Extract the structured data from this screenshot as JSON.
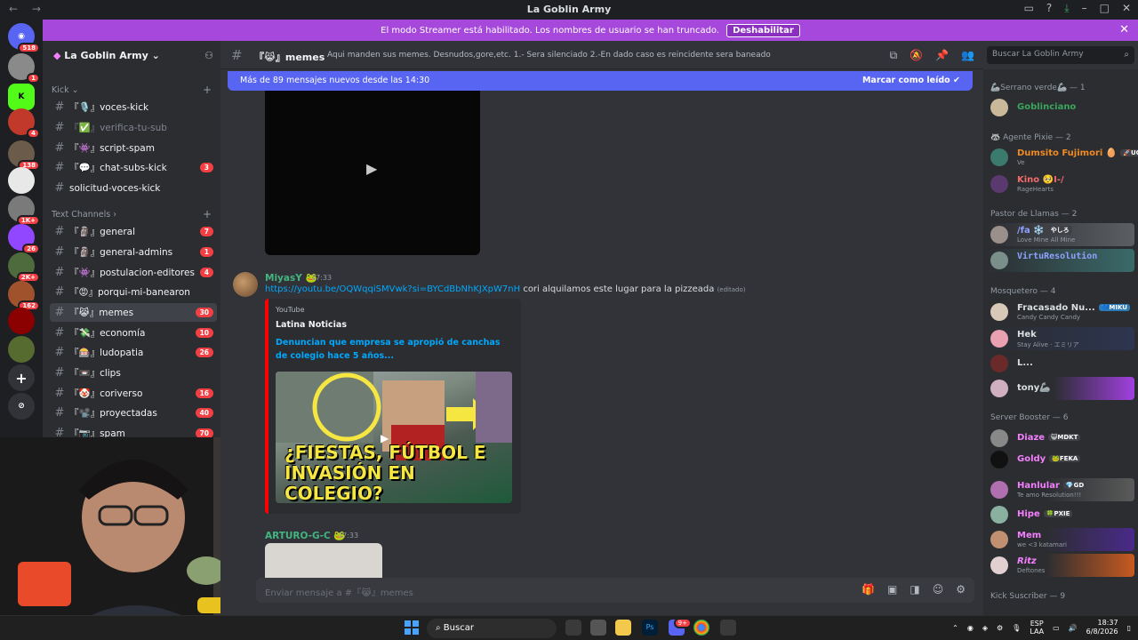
{
  "window": {
    "title": "La Goblin Army"
  },
  "streamer_banner": {
    "text": "El modo Streamer está habilitado. Los nombres de usuario se han truncado.",
    "button": "Deshabilitar"
  },
  "server_rail": {
    "badges": [
      "518",
      "1",
      "4",
      "138",
      "1K+",
      "26",
      "2K+",
      "162"
    ]
  },
  "sidebar": {
    "server_name": "La Goblin Army",
    "categories": {
      "kick": "Kick",
      "text": "Text Channels"
    },
    "kick_channels": [
      {
        "label": "『🎙️』voces-kick",
        "badge": ""
      },
      {
        "label": "『✅』verifica-tu-sub",
        "badge": ""
      },
      {
        "label": "『👾』script-spam",
        "badge": ""
      },
      {
        "label": "『💬』chat-subs-kick",
        "badge": "3"
      },
      {
        "label": "solicitud-voces-kick",
        "badge": ""
      }
    ],
    "text_channels": [
      {
        "label": "『🗿』general",
        "badge": "7"
      },
      {
        "label": "『🗿』general-admins",
        "badge": "1"
      },
      {
        "label": "『👾』postulacion-editores",
        "badge": "4"
      },
      {
        "label": "『😡』porqui-mi-banearon",
        "badge": ""
      },
      {
        "label": "『😹』memes",
        "badge": "30"
      },
      {
        "label": "『💸』economía",
        "badge": "10"
      },
      {
        "label": "『🎰』ludopatia",
        "badge": "26"
      },
      {
        "label": "『📼』clips",
        "badge": ""
      },
      {
        "label": "『🤡』coriverso",
        "badge": "16"
      },
      {
        "label": "『📽️』proyectadas",
        "badge": "40"
      },
      {
        "label": "『📷』spam",
        "badge": "70"
      }
    ]
  },
  "channel_header": {
    "name": "『😹』memes",
    "topic": "Aqui manden sus memes. Desnudos,gore,etc. 1.- Sera silenciado 2.-En dado caso es reincidente sera baneado",
    "search_placeholder": "Buscar La Goblin Army"
  },
  "new_messages_bar": {
    "text": "Más de 89 mensajes nuevos desde las 14:30",
    "action": "Marcar como leído"
  },
  "messages": [
    {
      "author": "MiyasY 🐸",
      "time": "17:33",
      "link": "https://youtu.be/OQWqqiSMVwk?si=BYCdBbNhKJXpW7nH",
      "text": " cori alquilamos este lugar para la pizzeada",
      "edited": "(editado)",
      "embed": {
        "provider": "YouTube",
        "author": "Latina Noticias",
        "title": "Denuncian que empresa se apropió de canchas de colegio hace 5 años...",
        "thumbnail_caption": "¿FIESTAS, FÚTBOL E INVASIÓN EN COLEGIO?"
      }
    },
    {
      "author": "ARTURO-G-C 🐸",
      "time": "17:33"
    }
  ],
  "composer": {
    "placeholder": "Enviar mensaje a #『😹』memes"
  },
  "members": {
    "groups": [
      {
        "title": "🦾Serrano verde🦾 — 1",
        "members": [
          {
            "name": "Goblinciano",
            "status": "",
            "color": "#3ba55c",
            "tag": ""
          }
        ]
      },
      {
        "title": "🦝 Agente Pixie — 2",
        "members": [
          {
            "name": "Dumsito Fujimori 🥚",
            "status": "Ve",
            "color": "#f08a24",
            "tag": "🚀UC"
          },
          {
            "name": "Kino 🥺I-/",
            "status": "RageHearts",
            "color": "#c77dff",
            "tag": ""
          }
        ]
      },
      {
        "title": "Pastor de Llamas — 2",
        "members": [
          {
            "name": "/fa ❄️",
            "status": "Love Mine All Mine",
            "color": "#8ea1ff",
            "tag": "やしろ"
          },
          {
            "name": "VirtuResolution",
            "status": "",
            "color": "#8ea1ff",
            "tag": ""
          }
        ]
      },
      {
        "title": "Mosquetero — 4",
        "members": [
          {
            "name": "Fracasado Nu...",
            "status": "Candy Candy Candy",
            "color": "#dbdee1",
            "tag": "💙MIKU"
          },
          {
            "name": "Hek",
            "status": "Stay Alive · エミリア",
            "color": "#dbdee1",
            "tag": ""
          },
          {
            "name": "L...",
            "status": "",
            "color": "#dbdee1",
            "tag": ""
          },
          {
            "name": "tony🦾",
            "status": "",
            "color": "#dbdee1",
            "tag": ""
          }
        ]
      },
      {
        "title": "Server Booster — 6",
        "members": [
          {
            "name": "Diaze",
            "status": "",
            "color": "#f47fff",
            "tag": "😺MDKT"
          },
          {
            "name": "Goldy",
            "status": "",
            "color": "#f47fff",
            "tag": "🐸FEKA"
          },
          {
            "name": "Hanlular",
            "status": "Te amo Resolution!!!",
            "color": "#f47fff",
            "tag": "💎GD"
          },
          {
            "name": "Hipe",
            "status": "",
            "color": "#f47fff",
            "tag": "🍀PXIE"
          },
          {
            "name": "Mem",
            "status": "we <3 katamari",
            "color": "#f47fff",
            "tag": ""
          },
          {
            "name": "Ritz",
            "status": "Deftones",
            "color": "#f47fff",
            "tag": ""
          }
        ]
      },
      {
        "title": "Kick Suscriber — 9",
        "members": []
      }
    ]
  },
  "taskbar": {
    "search": "Buscar",
    "lang": "ESP",
    "region": "LAA",
    "time": "18:37",
    "date": "6/8/2026",
    "notif_badge": "9+"
  },
  "colors": {
    "accent": "#5865f2",
    "banner": "#a748dc",
    "badge": "#f23f43",
    "link": "#00a8fc"
  }
}
